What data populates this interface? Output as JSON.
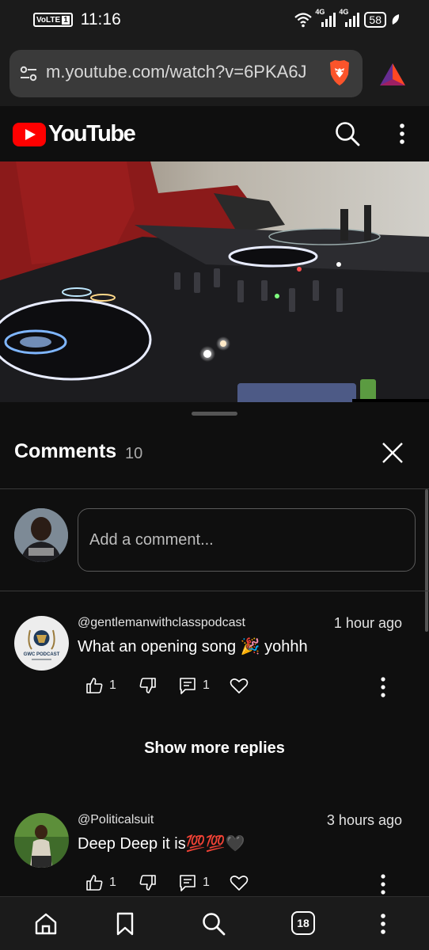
{
  "status_bar": {
    "volte": "VoLTE",
    "sim": "1",
    "time": "11:16",
    "net1": "4G",
    "net2": "4G",
    "battery": "58"
  },
  "browser": {
    "url": "m.youtube.com/watch?v=6PKA6J",
    "tab_count": "18"
  },
  "youtube": {
    "logo_text": "YouTube"
  },
  "comments_panel": {
    "title": "Comments",
    "count": "10",
    "input_placeholder": "Add a comment...",
    "show_more_label": "Show more replies",
    "comments": [
      {
        "author": "@gentlemanwithclasspodcast",
        "time": "1 hour ago",
        "text": "What an opening song 🎉 yohhh",
        "likes": "1",
        "replies": "1",
        "avatar_text": "GWC PODCAST"
      },
      {
        "author": "@Politicalsuit",
        "time": "3 hours ago",
        "text": "Deep Deep it is💯💯🖤",
        "likes": "1",
        "replies": "1"
      }
    ]
  },
  "colors": {
    "background": "#0f0f0f",
    "chrome": "#1b1b1b",
    "youtube_red": "#ff0000",
    "brave_orange": "#fb542b"
  }
}
